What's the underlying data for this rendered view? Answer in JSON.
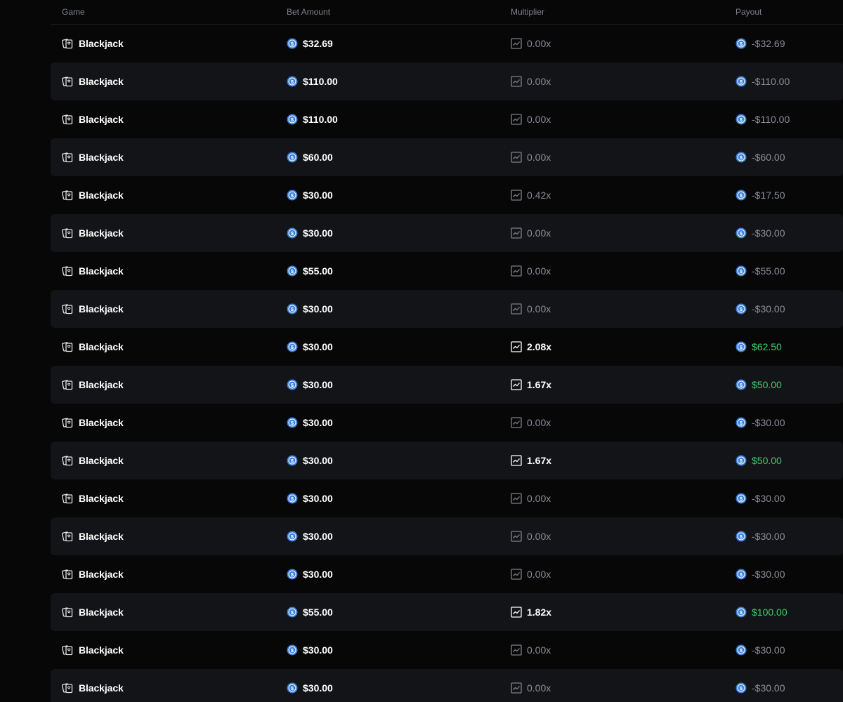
{
  "header": {
    "game": "Game",
    "bet_amount": "Bet Amount",
    "multiplier": "Multiplier",
    "payout": "Payout"
  },
  "icons": {
    "game": "cards-icon",
    "currency": "usd-coin-icon",
    "multiplier": "trend-chart-icon"
  },
  "colors": {
    "background": "#070708",
    "row_alt": "#131417",
    "muted": "#8a8e96",
    "win": "#3ecf6b",
    "coin": "#3b7fd9"
  },
  "rows": [
    {
      "game": "Blackjack",
      "bet": "$32.69",
      "multiplier": "0.00x",
      "payout": "-$32.69",
      "win": false
    },
    {
      "game": "Blackjack",
      "bet": "$110.00",
      "multiplier": "0.00x",
      "payout": "-$110.00",
      "win": false
    },
    {
      "game": "Blackjack",
      "bet": "$110.00",
      "multiplier": "0.00x",
      "payout": "-$110.00",
      "win": false
    },
    {
      "game": "Blackjack",
      "bet": "$60.00",
      "multiplier": "0.00x",
      "payout": "-$60.00",
      "win": false
    },
    {
      "game": "Blackjack",
      "bet": "$30.00",
      "multiplier": "0.42x",
      "payout": "-$17.50",
      "win": false
    },
    {
      "game": "Blackjack",
      "bet": "$30.00",
      "multiplier": "0.00x",
      "payout": "-$30.00",
      "win": false
    },
    {
      "game": "Blackjack",
      "bet": "$55.00",
      "multiplier": "0.00x",
      "payout": "-$55.00",
      "win": false
    },
    {
      "game": "Blackjack",
      "bet": "$30.00",
      "multiplier": "0.00x",
      "payout": "-$30.00",
      "win": false
    },
    {
      "game": "Blackjack",
      "bet": "$30.00",
      "multiplier": "2.08x",
      "payout": "$62.50",
      "win": true
    },
    {
      "game": "Blackjack",
      "bet": "$30.00",
      "multiplier": "1.67x",
      "payout": "$50.00",
      "win": true
    },
    {
      "game": "Blackjack",
      "bet": "$30.00",
      "multiplier": "0.00x",
      "payout": "-$30.00",
      "win": false
    },
    {
      "game": "Blackjack",
      "bet": "$30.00",
      "multiplier": "1.67x",
      "payout": "$50.00",
      "win": true
    },
    {
      "game": "Blackjack",
      "bet": "$30.00",
      "multiplier": "0.00x",
      "payout": "-$30.00",
      "win": false
    },
    {
      "game": "Blackjack",
      "bet": "$30.00",
      "multiplier": "0.00x",
      "payout": "-$30.00",
      "win": false
    },
    {
      "game": "Blackjack",
      "bet": "$30.00",
      "multiplier": "0.00x",
      "payout": "-$30.00",
      "win": false
    },
    {
      "game": "Blackjack",
      "bet": "$55.00",
      "multiplier": "1.82x",
      "payout": "$100.00",
      "win": true
    },
    {
      "game": "Blackjack",
      "bet": "$30.00",
      "multiplier": "0.00x",
      "payout": "-$30.00",
      "win": false
    },
    {
      "game": "Blackjack",
      "bet": "$30.00",
      "multiplier": "0.00x",
      "payout": "-$30.00",
      "win": false
    }
  ]
}
